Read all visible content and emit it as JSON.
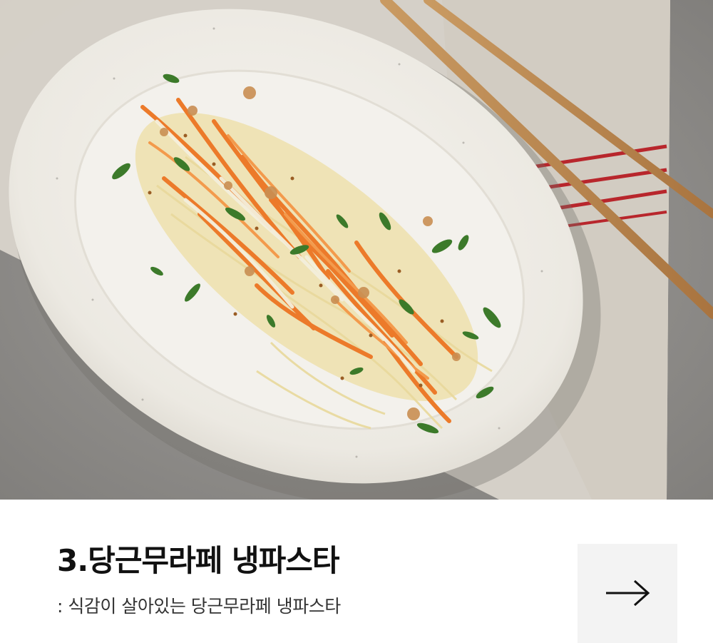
{
  "recipe": {
    "title": "3.당근무라페 냉파스타",
    "subtitle": ": 식감이 살아있는 당근무라페 냉파스타"
  },
  "arrow_button": {
    "icon": "arrow-right-icon"
  },
  "colors": {
    "background": "#ffffff",
    "title": "#111111",
    "subtitle": "#333333",
    "button_bg": "#f3f3f3"
  }
}
